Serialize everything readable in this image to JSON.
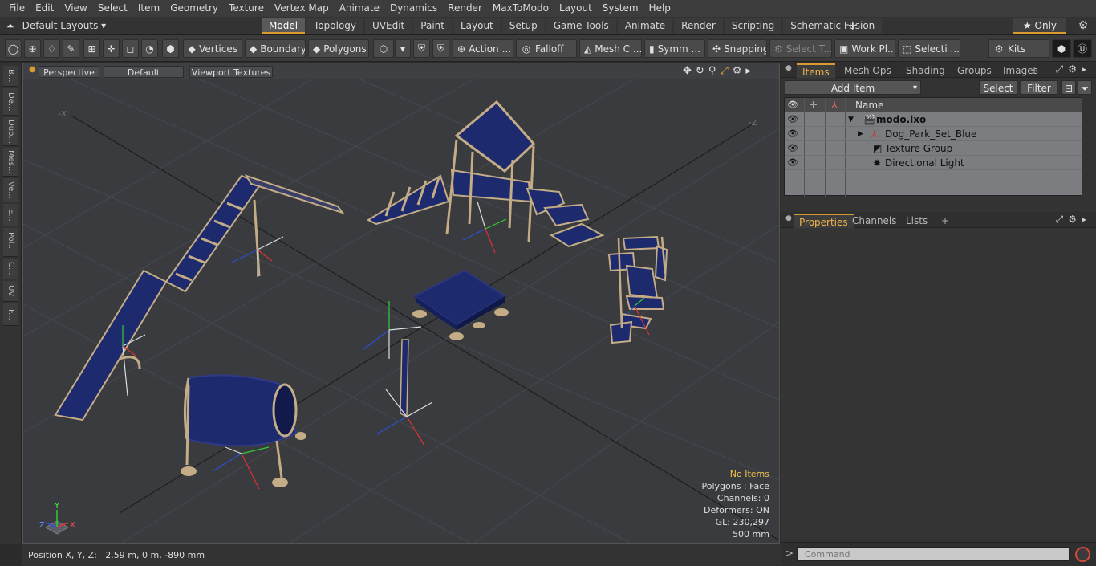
{
  "menu": [
    "File",
    "Edit",
    "View",
    "Select",
    "Item",
    "Geometry",
    "Texture",
    "Vertex Map",
    "Animate",
    "Dynamics",
    "Render",
    "MaxToModo",
    "Layout",
    "System",
    "Help"
  ],
  "layouts": {
    "label": "Default Layouts",
    "arrow": "▾",
    "up_icon": "⏶"
  },
  "tabs": [
    "Model",
    "Topology",
    "UVEdit",
    "Paint",
    "Layout",
    "Setup",
    "Game Tools",
    "Animate",
    "Render",
    "Scripting",
    "Schematic Fusion"
  ],
  "active_tab": "Model",
  "add_tab": "+",
  "only": "★  Only",
  "toolbar": {
    "vertices": "Vertices",
    "boundary": "Boundary",
    "polygons": "Polygons",
    "action": "Action",
    "action_more": "...",
    "falloff": "Falloff",
    "mesh": "Mesh C ...",
    "symm": "Symm ...",
    "snapping": "Snapping",
    "select_t": "Select T...",
    "work_pl": "Work Pl...",
    "selecti": "Selecti ...",
    "kits": "Kits"
  },
  "left_tabs": [
    "B...",
    "De...",
    "Dup...",
    "Mes...",
    "Ve...",
    "E...",
    "Pol...",
    "C...",
    "UV",
    "F..."
  ],
  "viewport": {
    "view": "Perspective",
    "shading": "Default",
    "textures": "Viewport Textures",
    "axis_x": "X",
    "axis_y": "Y",
    "axis_z": "Z",
    "corner_x": "-X",
    "corner_z": "-Z"
  },
  "info": {
    "no_items": "No Items",
    "polygons": "Polygons : Face",
    "channels": "Channels: 0",
    "deformers": "Deformers: ON",
    "gl": "GL: 230,297",
    "scale": "500 mm"
  },
  "status": "Position X, Y, Z:   2.59 m, 0 m, -890 mm",
  "items_panel": {
    "tabs": [
      "Items",
      "Mesh Ops",
      "Shading",
      "Groups",
      "Images"
    ],
    "add_item": "Add Item",
    "select": "Select",
    "filter": "Filter",
    "col_name": "Name",
    "rows": [
      {
        "name": "modo.lxo",
        "bold": true
      },
      {
        "name": "Dog_Park_Set_Blue"
      },
      {
        "name": "Texture Group"
      },
      {
        "name": "Directional Light"
      }
    ]
  },
  "props_panel": {
    "tabs": [
      "Properties",
      "Channels",
      "Lists"
    ]
  },
  "command": {
    "placeholder": "Command"
  },
  "colors": {
    "accent": "#d99a2f",
    "mesh": "#1e2a6e",
    "frame": "#c4ad86",
    "grid": "#45484d"
  }
}
